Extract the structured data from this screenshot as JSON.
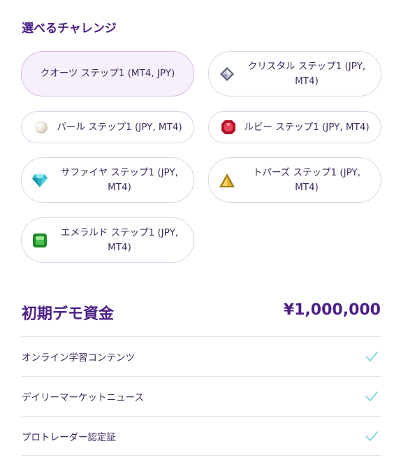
{
  "section_title": "選べるチャレンジ",
  "options": [
    {
      "label": "クオーツ ステップ1 (MT4, JPY)",
      "icon": "none",
      "selected": true
    },
    {
      "label": "クリスタル ステップ1 (JPY, MT4)",
      "icon": "crystal-icon",
      "selected": false
    },
    {
      "label": "パール ステップ1 (JPY, MT4)",
      "icon": "pearl-icon",
      "selected": false
    },
    {
      "label": "ルビー ステップ1 (JPY, MT4)",
      "icon": "ruby-icon",
      "selected": false
    },
    {
      "label": "サファイヤ ステップ1 (JPY, MT4)",
      "icon": "sapphire-icon",
      "selected": false
    },
    {
      "label": "トパーズ ステップ1 (JPY, MT4)",
      "icon": "topaz-icon",
      "selected": false
    },
    {
      "label": "エメラルド ステップ1 (JPY, MT4)",
      "icon": "emerald-icon",
      "selected": false
    }
  ],
  "demo_funds": {
    "label": "初期デモ資金",
    "value": "¥1,000,000"
  },
  "features": [
    {
      "label": "オンライン学習コンテンツ",
      "included": true
    },
    {
      "label": "デイリーマーケットニュース",
      "included": true
    },
    {
      "label": "プロトレーダー認定証",
      "included": true
    }
  ],
  "colors": {
    "accent": "#4b1f86",
    "check": "#7fd6de",
    "selected_bg": "#f8effc",
    "border": "#ddd3ea"
  }
}
